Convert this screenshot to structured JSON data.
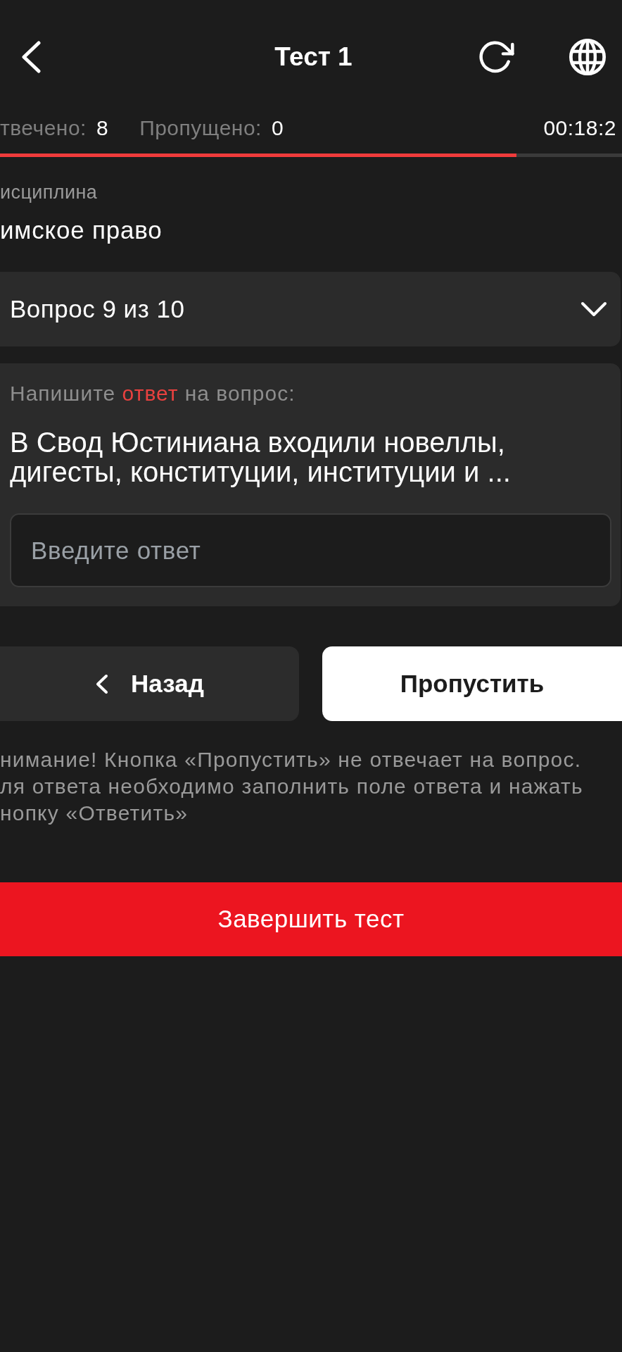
{
  "header": {
    "title": "Тест 1"
  },
  "stats": [
    {
      "label": "твечено:",
      "value": "8"
    },
    {
      "label": "Пропущено:",
      "value": "0"
    }
  ],
  "timer": "00:18:2",
  "progress": {
    "level": 0.83
  },
  "discipline": {
    "label": "исциплина",
    "value": "имское право"
  },
  "question_picker": {
    "value": "Вопрос 9 из 10",
    "expanded": false
  },
  "question_card": {
    "prompt": [
      {
        "text": "Напишите ",
        "highlight": false
      },
      {
        "text": "ответ",
        "highlight": true
      },
      {
        "text": " на вопрос:",
        "highlight": false
      }
    ],
    "question": "В Свод Юстиниана входили новеллы, дигесты, конституции, институции и ...",
    "answer_field": {
      "placeholder": "Введите ответ"
    }
  },
  "buttons": [
    {
      "kind": "back",
      "label": "Назад"
    },
    {
      "kind": "skip",
      "label": "Пропустить"
    }
  ],
  "warning": {
    "lines": [
      "нимание! Кнопка «Пропустить» не отвечает на вопрос.",
      "ля ответа необходимо заполнить поле ответа и нажать",
      "нопку «Ответить»"
    ]
  },
  "finish_button": {
    "label": "Завершить тест"
  }
}
